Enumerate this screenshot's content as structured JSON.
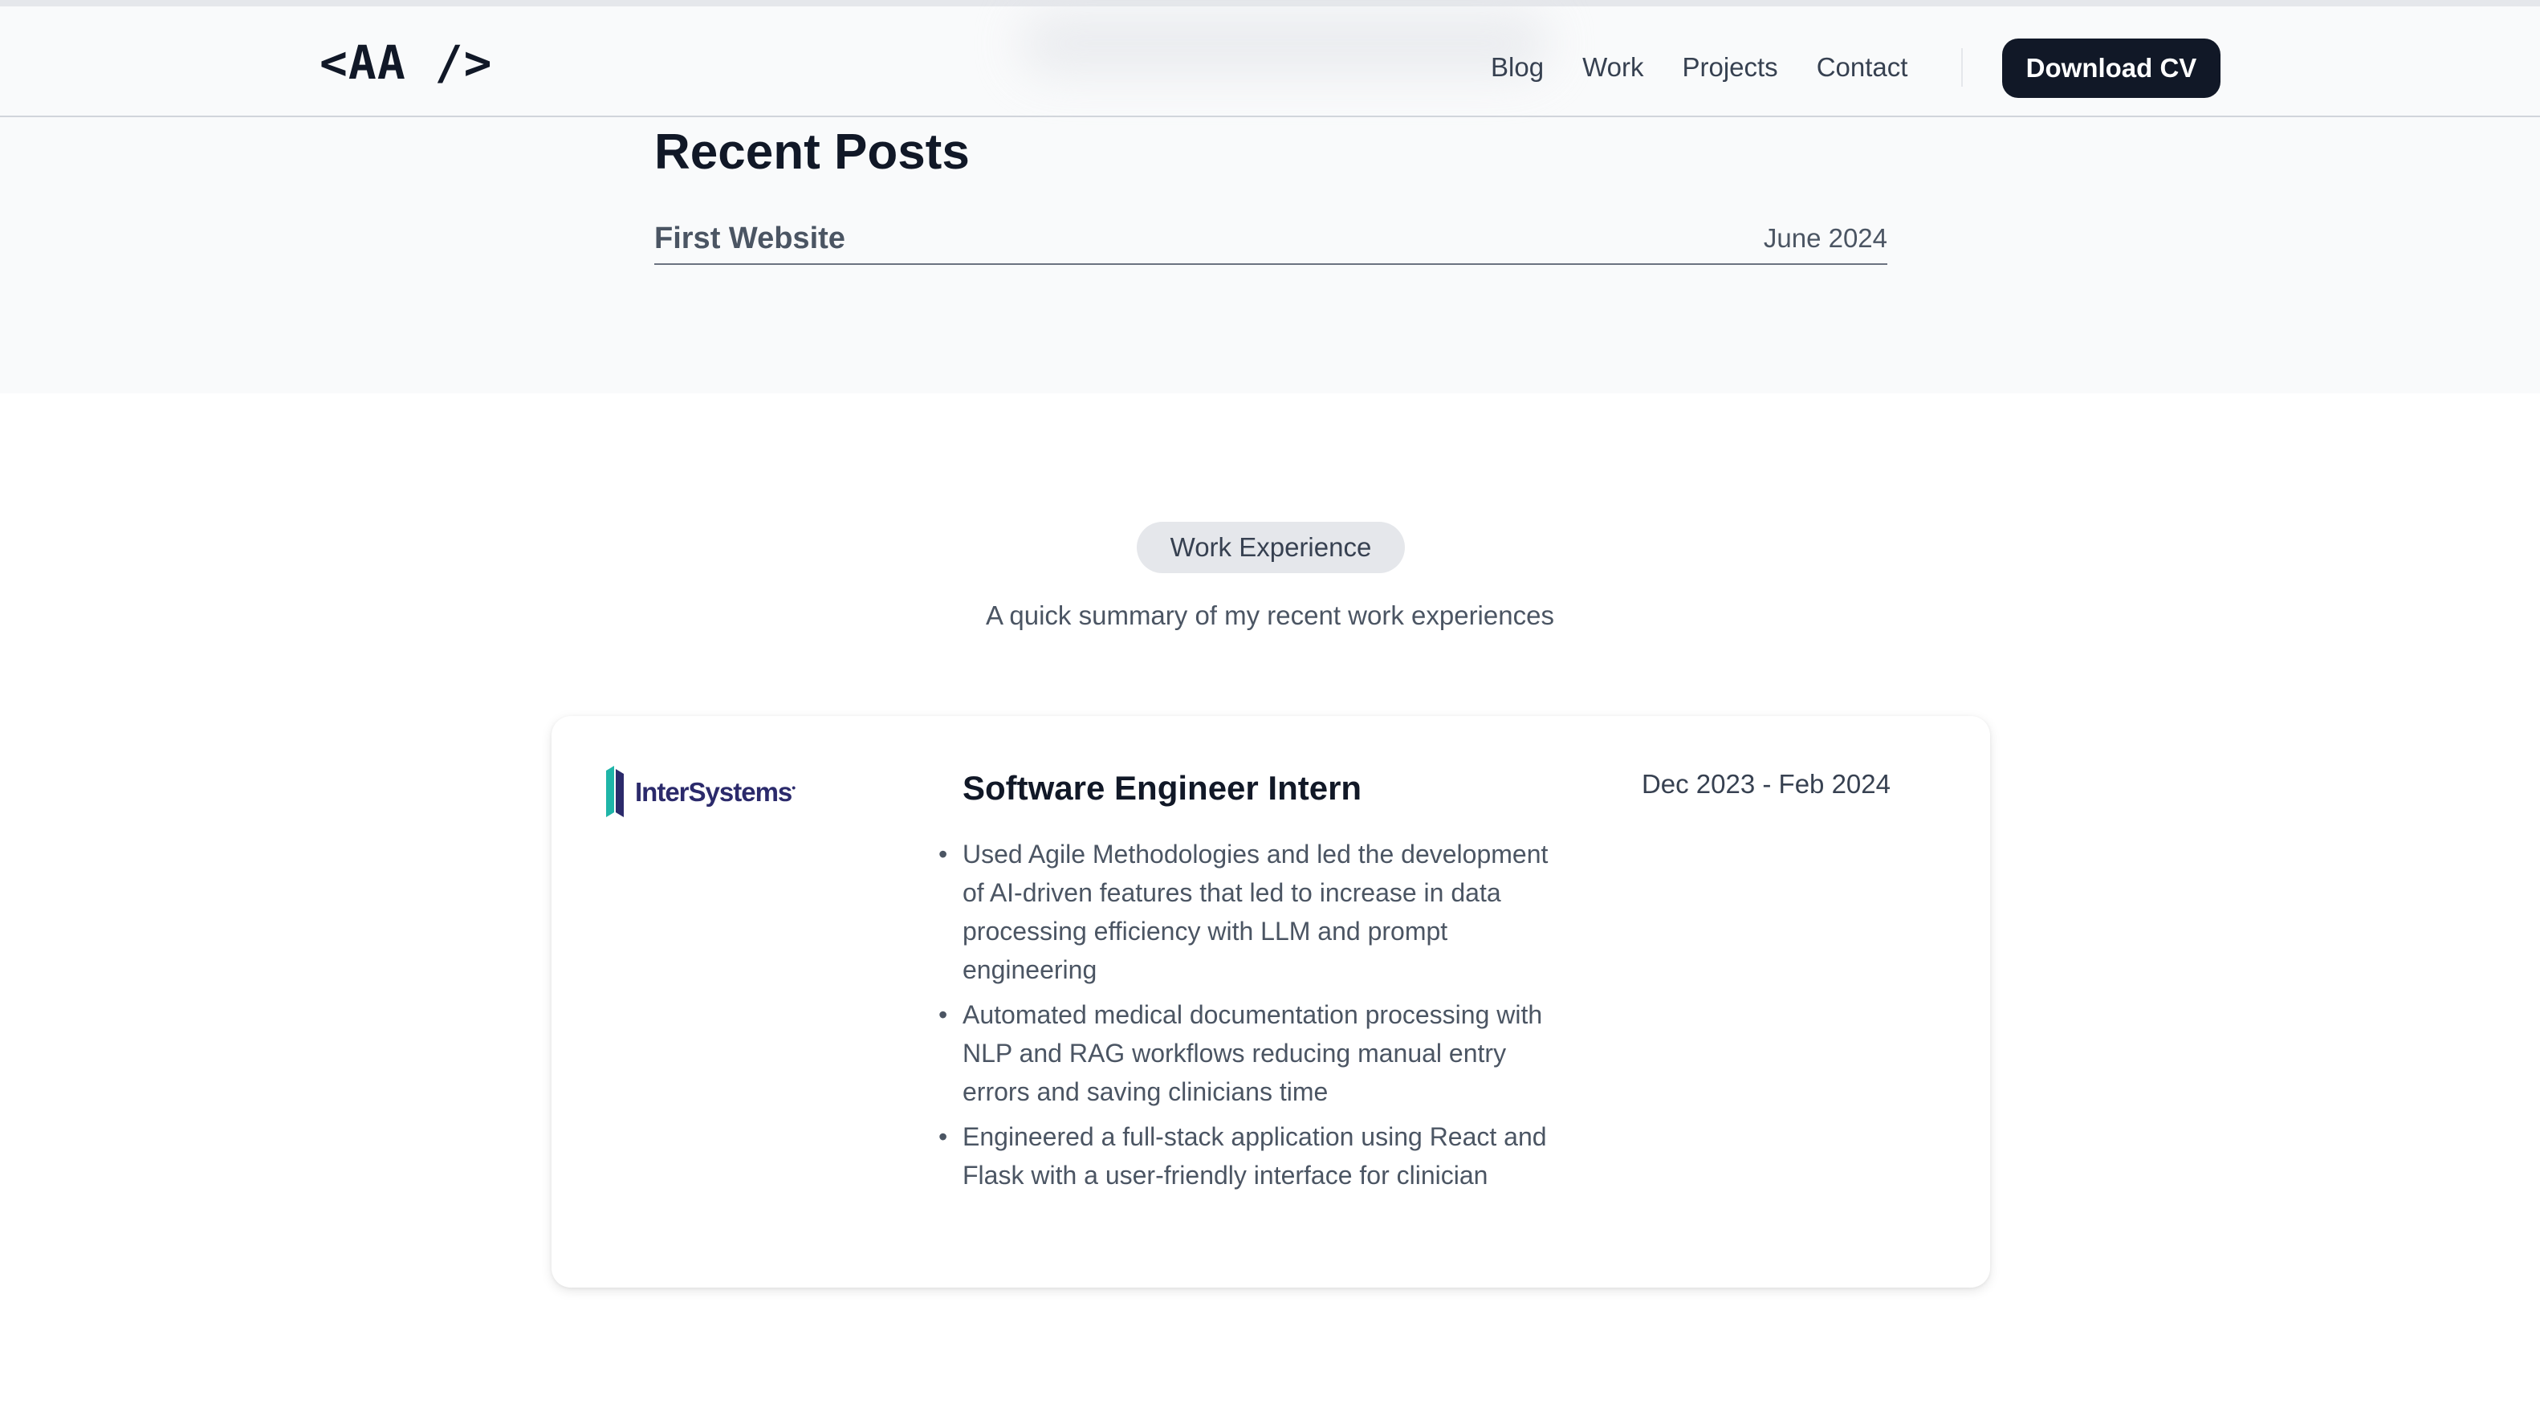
{
  "header": {
    "logo": "<AA />",
    "nav": [
      {
        "label": "Blog"
      },
      {
        "label": "Work"
      },
      {
        "label": "Projects"
      },
      {
        "label": "Contact"
      }
    ],
    "cta_label": "Download CV"
  },
  "recent_posts": {
    "title": "Recent Posts",
    "items": [
      {
        "title": "First Website",
        "date": "June 2024"
      }
    ]
  },
  "work": {
    "badge": "Work Experience",
    "subtitle": "A quick summary of my recent work experiences",
    "jobs": [
      {
        "company": "InterSystems",
        "company_logo_icon": "intersystems-logo",
        "title": "Software Engineer Intern",
        "dates": "Dec 2023 - Feb 2024",
        "bullets": [
          "Used Agile Methodologies and led the development of AI-driven features that led to increase in data processing efficiency with LLM and prompt engineering",
          "Automated medical documentation processing with NLP and RAG workflows reducing manual entry errors and saving clinicians time",
          "Engineered a full-stack application using React and Flask with a user-friendly interface for clinician"
        ]
      }
    ]
  },
  "colors": {
    "primary": "#111827",
    "muted_text": "#4b5563",
    "badge_bg": "#e5e7eb",
    "section_bg": "#f9fafb",
    "brand_teal": "#1fb5a8",
    "brand_navy": "#2b2a6b"
  }
}
